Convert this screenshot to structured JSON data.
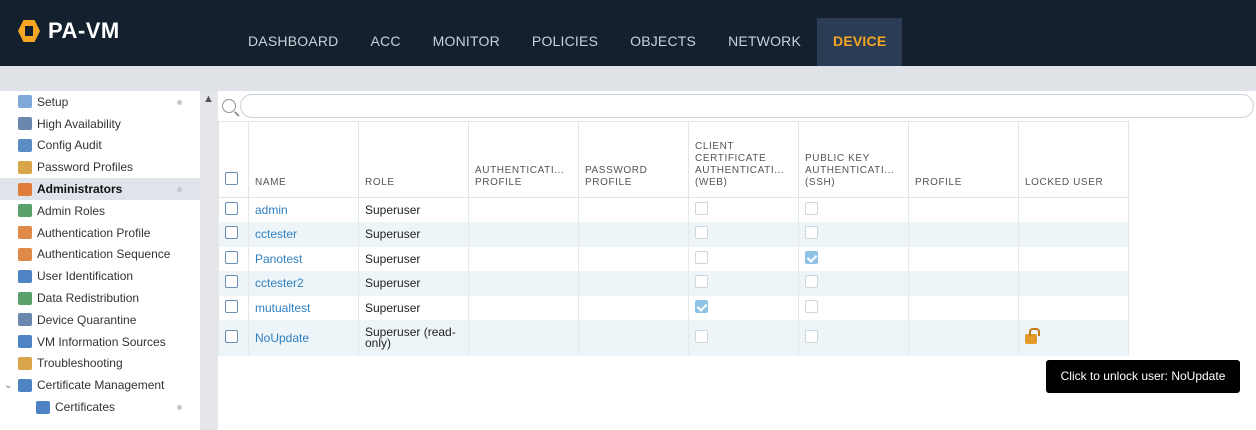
{
  "app": {
    "logo_text": "PA-VM"
  },
  "nav": {
    "tabs": [
      {
        "label": "DASHBOARD",
        "active": false
      },
      {
        "label": "ACC",
        "active": false
      },
      {
        "label": "MONITOR",
        "active": false
      },
      {
        "label": "POLICIES",
        "active": false
      },
      {
        "label": "OBJECTS",
        "active": false
      },
      {
        "label": "NETWORK",
        "active": false
      },
      {
        "label": "DEVICE",
        "active": true
      }
    ]
  },
  "sidebar": {
    "items": [
      {
        "label": "Setup",
        "icon": "setup-icon",
        "color": "#7fa8d8"
      },
      {
        "label": "High Availability",
        "icon": "high-availability-icon",
        "color": "#6b87ad"
      },
      {
        "label": "Config Audit",
        "icon": "config-audit-icon",
        "color": "#5c8cc4"
      },
      {
        "label": "Password Profiles",
        "icon": "password-profiles-icon",
        "color": "#d8a54a"
      },
      {
        "label": "Administrators",
        "icon": "administrators-icon",
        "color": "#e07b3b",
        "active": true
      },
      {
        "label": "Admin Roles",
        "icon": "admin-roles-icon",
        "color": "#5aa06a"
      },
      {
        "label": "Authentication Profile",
        "icon": "authentication-profile-icon",
        "color": "#e08a4a"
      },
      {
        "label": "Authentication Sequence",
        "icon": "authentication-sequence-icon",
        "color": "#e08a4a"
      },
      {
        "label": "User Identification",
        "icon": "user-identification-icon",
        "color": "#4f84c4"
      },
      {
        "label": "Data Redistribution",
        "icon": "data-redistribution-icon",
        "color": "#5aa06a"
      },
      {
        "label": "Device Quarantine",
        "icon": "device-quarantine-icon",
        "color": "#6b87ad"
      },
      {
        "label": "VM Information Sources",
        "icon": "vm-information-sources-icon",
        "color": "#4f84c4"
      },
      {
        "label": "Troubleshooting",
        "icon": "troubleshooting-icon",
        "color": "#d8a54a"
      },
      {
        "label": "Certificate Management",
        "icon": "certificate-management-icon",
        "color": "#4f84c4"
      },
      {
        "label": "Certificates",
        "icon": "certificates-icon",
        "color": "#4f84c4"
      }
    ]
  },
  "table": {
    "headers": {
      "name": "NAME",
      "role": "ROLE",
      "auth_profile": "AUTHENTICATI... PROFILE",
      "password_profile": "PASSWORD PROFILE",
      "client_cert": "CLIENT CERTIFICATE AUTHENTICATI... (WEB)",
      "public_key": "PUBLIC KEY AUTHENTICATI... (SSH)",
      "profile": "PROFILE",
      "locked_user": "LOCKED USER"
    },
    "rows": [
      {
        "name": "admin",
        "role": "Superuser",
        "client_cert": false,
        "public_key": false,
        "locked": false
      },
      {
        "name": "cctester",
        "role": "Superuser",
        "client_cert": false,
        "public_key": false,
        "locked": false
      },
      {
        "name": "Panotest",
        "role": "Superuser",
        "client_cert": false,
        "public_key": true,
        "locked": false
      },
      {
        "name": "cctester2",
        "role": "Superuser",
        "client_cert": false,
        "public_key": false,
        "locked": false
      },
      {
        "name": "mutualtest",
        "role": "Superuser",
        "client_cert": true,
        "public_key": false,
        "locked": false
      },
      {
        "name": "NoUpdate",
        "role": "Superuser (read-only)",
        "client_cert": false,
        "public_key": false,
        "locked": true
      }
    ]
  },
  "tooltip": {
    "text": "Click to unlock user: NoUpdate"
  }
}
